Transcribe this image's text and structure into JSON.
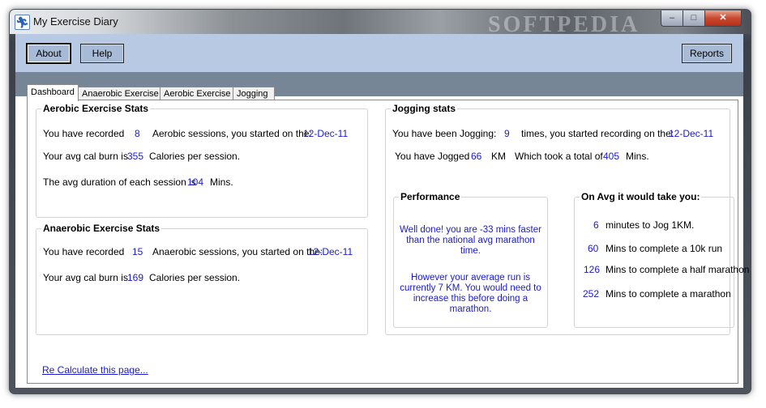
{
  "window": {
    "title": "My Exercise Diary",
    "watermark": "SOFTPEDIA"
  },
  "toolbar": {
    "about": "About",
    "help": "Help",
    "reports": "Reports"
  },
  "tabs": [
    "Dashboard",
    "Anaerobic Exercise",
    "Aerobic Exercise",
    "Jogging"
  ],
  "aerobic": {
    "title": "Aerobic Exercise Stats",
    "recorded_prefix": "You have recorded",
    "sessions": "8",
    "recorded_suffix": "Aerobic sessions, you started on the:",
    "start_date": "12-Dec-11",
    "cal_prefix": "Your avg cal burn is",
    "cal_value": "355",
    "cal_suffix": "Calories per session.",
    "dur_prefix": "The avg duration of each session is",
    "dur_value": "104",
    "dur_suffix": "Mins."
  },
  "anaerobic": {
    "title": "Anaerobic Exercise Stats",
    "recorded_prefix": "You have recorded",
    "sessions": "15",
    "recorded_suffix": "Anaerobic sessions, you started on the:",
    "start_date": "12-Dec-11",
    "cal_prefix": "Your avg cal burn is",
    "cal_value": "169",
    "cal_suffix": "Calories per session."
  },
  "jogging": {
    "title": "Jogging stats",
    "jog_prefix": "You have been Jogging:",
    "jog_times": "9",
    "jog_suffix": "times,  you started recording on the:",
    "start_date": "12-Dec-11",
    "km_prefix": "You have Jogged",
    "km_value": "66",
    "km_unit": "KM",
    "took_label": "Which took a total of",
    "total_mins": "405",
    "mins_unit": "Mins."
  },
  "performance": {
    "title": "Performance",
    "message1": "Well done! you are -33 mins faster than the national avg marathon time.",
    "message2": "However your average run is currently 7 KM. You would need to increase this before doing a marathon."
  },
  "on_avg": {
    "title": "On Avg it would take you:",
    "rows": [
      {
        "value": "6",
        "label": "minutes to Jog 1KM."
      },
      {
        "value": "60",
        "label": "Mins to complete a 10k run"
      },
      {
        "value": "126",
        "label": "Mins to complete a half marathon"
      },
      {
        "value": "252",
        "label": "Mins to complete a marathon"
      }
    ]
  },
  "recalc_link": "Re Calculate this page..."
}
